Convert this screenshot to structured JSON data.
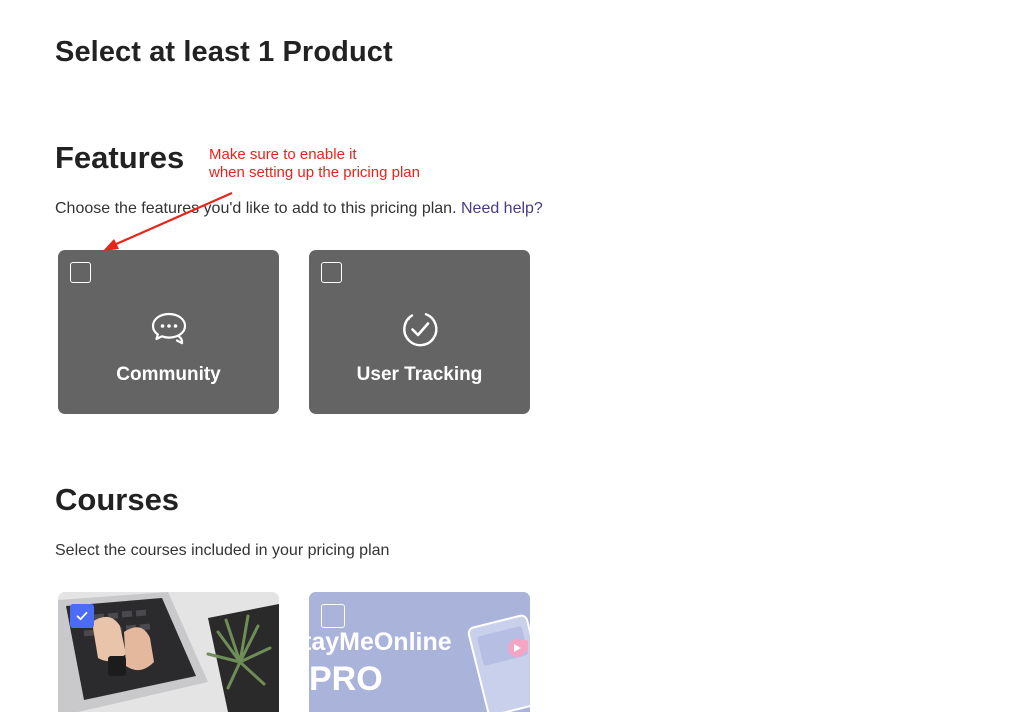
{
  "page": {
    "title": "Select at least 1 Product"
  },
  "annotation": {
    "text": "Make sure to enable it\nwhen setting up the pricing plan",
    "color": "#e8241a"
  },
  "features": {
    "title": "Features",
    "description": "Choose the features you'd like to add to this pricing plan.",
    "help_link": "Need help?",
    "items": [
      {
        "label": "Community",
        "icon": "chat-bubbles-icon",
        "checked": false
      },
      {
        "label": "User Tracking",
        "icon": "check-circle-icon",
        "checked": false
      }
    ]
  },
  "courses": {
    "title": "Courses",
    "description": "Select the courses included in your pricing plan",
    "items": [
      {
        "image": "laptop-hands-photo",
        "checked": true
      },
      {
        "image_text_line1": "tayMeOnline",
        "image_text_line2": "PRO",
        "checked": false
      }
    ]
  },
  "colors": {
    "card_bg": "#646464",
    "checkbox_checked": "#4a6cf7",
    "link": "#4a3a86",
    "course_thumb_bg": "#aab3d9"
  }
}
